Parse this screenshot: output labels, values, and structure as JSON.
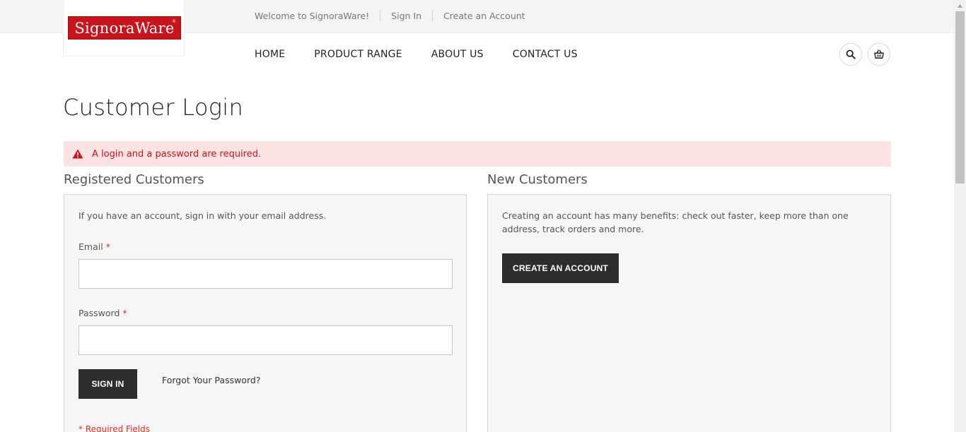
{
  "header": {
    "welcome_text": "Welcome to SignoraWare!",
    "sign_in_link": "Sign In",
    "create_account_link": "Create an Account",
    "logo_text": "SignoraWare",
    "logo_mark": "®"
  },
  "nav": {
    "items": [
      {
        "label": "HOME"
      },
      {
        "label": "PRODUCT RANGE"
      },
      {
        "label": "ABOUT US"
      },
      {
        "label": "CONTACT US"
      }
    ],
    "icons": [
      "search-icon",
      "basket-icon"
    ]
  },
  "page": {
    "title": "Customer Login",
    "error_message": "A login and a password are required."
  },
  "registered": {
    "title": "Registered Customers",
    "intro": "If you have an account, sign in with your email address.",
    "email_label": "Email",
    "password_label": "Password",
    "required_mark": "*",
    "email_value": "",
    "password_value": "",
    "sign_in_button": "SIGN IN",
    "forgot_link": "Forgot Your Password?",
    "required_note": "* Required Fields"
  },
  "new_customers": {
    "title": "New Customers",
    "text": "Creating an account has many benefits: check out faster, keep more than one address, track orders and more.",
    "create_button": "CREATE AN ACCOUNT"
  },
  "colors": {
    "brand_red": "#c8141c",
    "error_bg": "#fbe3e3",
    "button_dark": "#2d2d2d",
    "required_red": "#e02b27"
  }
}
